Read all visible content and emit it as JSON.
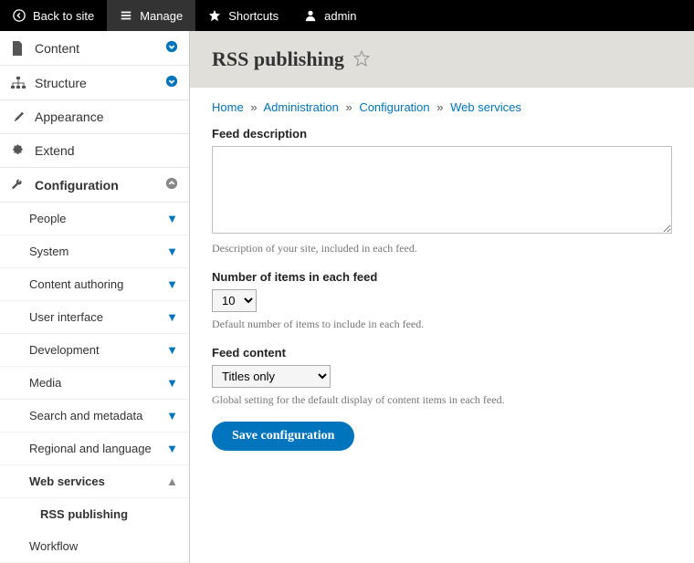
{
  "toolbar": {
    "back": "Back to site",
    "manage": "Manage",
    "shortcuts": "Shortcuts",
    "admin": "admin"
  },
  "nav": {
    "content": "Content",
    "structure": "Structure",
    "appearance": "Appearance",
    "extend": "Extend",
    "configuration": {
      "label": "Configuration",
      "items": {
        "people": "People",
        "system": "System",
        "content_authoring": "Content authoring",
        "user_interface": "User interface",
        "development": "Development",
        "media": "Media",
        "search_metadata": "Search and metadata",
        "regional_language": "Regional and language",
        "web_services": {
          "label": "Web services",
          "rss_publishing": "RSS publishing"
        },
        "workflow": "Workflow"
      }
    }
  },
  "page": {
    "title": "RSS publishing",
    "breadcrumb": {
      "home": "Home",
      "administration": "Administration",
      "configuration": "Configuration",
      "web_services": "Web services"
    }
  },
  "form": {
    "feed_description": {
      "label": "Feed description",
      "value": "",
      "help": "Description of your site, included in each feed."
    },
    "number_of_items": {
      "label": "Number of items in each feed",
      "value": "10",
      "help": "Default number of items to include in each feed."
    },
    "feed_content": {
      "label": "Feed content",
      "value": "Titles only",
      "help": "Global setting for the default display of content items in each feed."
    },
    "submit": "Save configuration"
  }
}
